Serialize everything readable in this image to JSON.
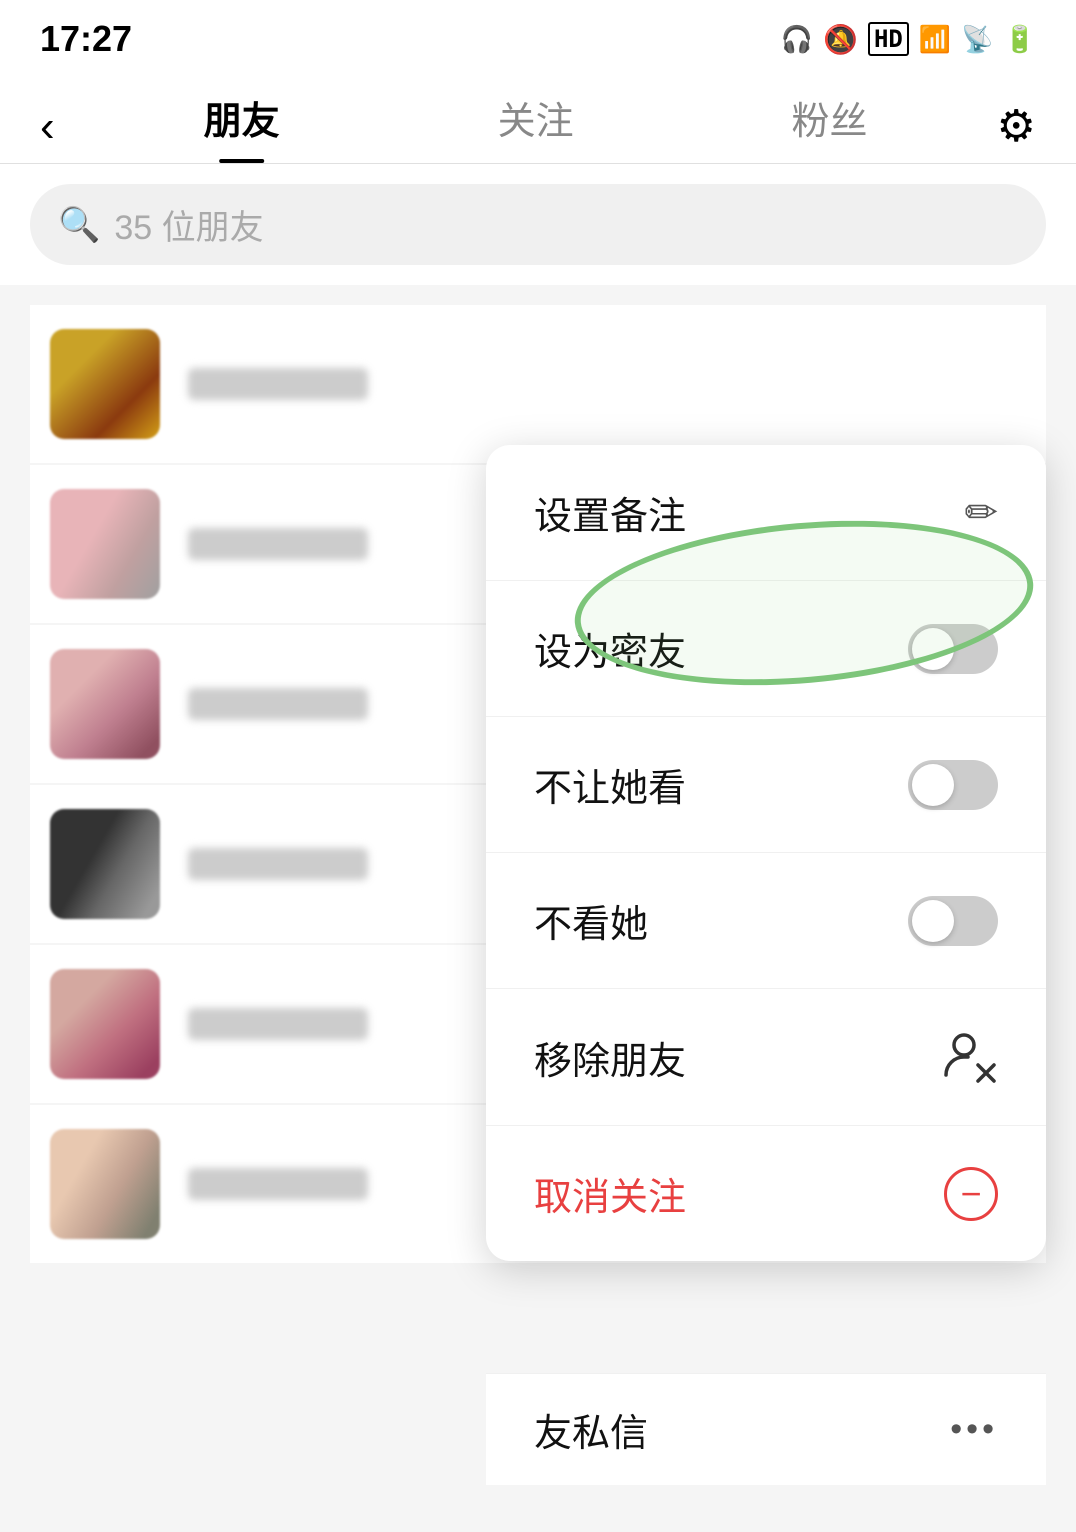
{
  "statusBar": {
    "time": "17:27",
    "icons": [
      "headphone",
      "mute",
      "hd",
      "signal",
      "wifi",
      "battery"
    ]
  },
  "header": {
    "backLabel": "‹",
    "tabs": [
      {
        "label": "朋友",
        "active": true
      },
      {
        "label": "关注",
        "active": false
      },
      {
        "label": "粉丝",
        "active": false
      }
    ],
    "settingsLabel": "⚙"
  },
  "search": {
    "placeholder": "35 位朋友"
  },
  "contextMenu": {
    "items": [
      {
        "id": "set-remark",
        "label": "设置备注",
        "iconType": "edit",
        "type": "normal"
      },
      {
        "id": "set-close-friend",
        "label": "设为密友",
        "iconType": "toggle",
        "type": "normal",
        "highlighted": true
      },
      {
        "id": "hide-from-her",
        "label": "不让她看",
        "iconType": "toggle",
        "type": "normal"
      },
      {
        "id": "hide-her",
        "label": "不看她",
        "iconType": "toggle",
        "type": "normal"
      },
      {
        "id": "remove-friend",
        "label": "移除朋友",
        "iconType": "remove-user",
        "type": "normal"
      },
      {
        "id": "unfollow",
        "label": "取消关注",
        "iconType": "unfollow",
        "type": "danger"
      }
    ]
  },
  "bottomPartial": {
    "label": "友私信",
    "iconLabel": "•••"
  }
}
